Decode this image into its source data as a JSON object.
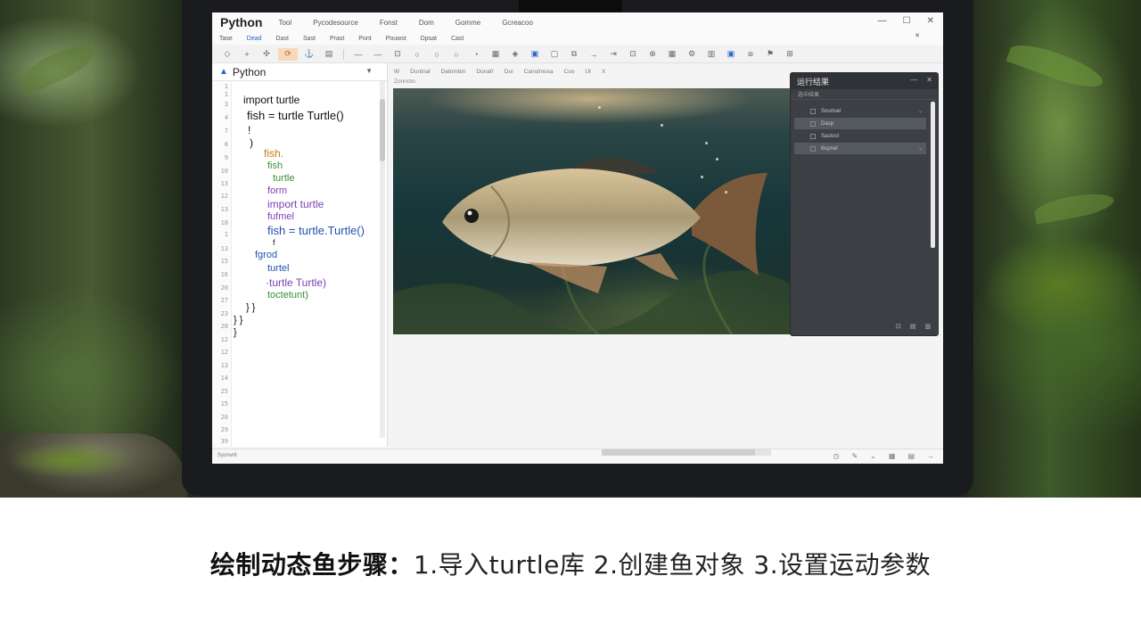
{
  "window": {
    "app_title": "Python",
    "title_menus": [
      "Tool",
      "Pycodesource",
      "Fonst",
      "Dom",
      "Gomme",
      "Gcreacoo"
    ],
    "controls": [
      "—",
      "☐",
      "✕"
    ]
  },
  "menubar": {
    "items": [
      "Tase",
      "Dead",
      "Dast",
      "Sast",
      "Prast",
      "Pont",
      "Pouwst",
      "Dpsat",
      "Cast"
    ],
    "active_index": 1,
    "close": "✕"
  },
  "editor": {
    "tab_title": "Python",
    "line_numbers": [
      "1",
      "1",
      "3",
      "4",
      "7",
      "8",
      "9",
      "10",
      "13",
      "12",
      "13",
      "18",
      "1",
      "13",
      "15",
      "16",
      "20",
      "27",
      "23",
      "28",
      "12",
      "12",
      "13",
      "14",
      "25",
      "15",
      "20",
      "29",
      "39"
    ],
    "code_lines": [
      {
        "text": "import turtle",
        "color": "#111111"
      },
      {
        "text": "fish = turtle Turtle()",
        "color": "#111111"
      },
      {
        "text": "!",
        "color": "#111111"
      },
      {
        "text": ")",
        "color": "#111111"
      },
      {
        "text": "fish.",
        "color": "#c07a10"
      },
      {
        "text": "fish",
        "color": "#3b8e3b"
      },
      {
        "text": "turtle",
        "color": "#3b8e3b"
      },
      {
        "text": "form",
        "color": "#7b3fb5"
      },
      {
        "text": "import turtle",
        "color": "#7b3fb5"
      },
      {
        "text": "fufmel",
        "color": "#7b3fb5"
      },
      {
        "text": "fish = turtle.Turtle()",
        "color": "#2350b0"
      },
      {
        "text": "f",
        "color": "#111111"
      },
      {
        "text": "fgrod",
        "color": "#2350b0"
      },
      {
        "text": "turtel",
        "color": "#2350b0"
      },
      {
        "text": "·turtle Turtle)",
        "color": "#7b3fb5"
      },
      {
        "text": "toctetunt)",
        "color": "#3b8e3b"
      },
      {
        "text": "} }",
        "color": "#111111"
      },
      {
        "text": "}  }",
        "color": "#111111"
      },
      {
        "text": "}",
        "color": "#111111"
      }
    ]
  },
  "subbar": {
    "items": [
      "W",
      "Duntnal",
      "Datnmbin",
      "Donafr",
      "Dui",
      "Canstmosa",
      "Coo",
      "Ut",
      "X"
    ],
    "breadcrumb": "Zonnoto"
  },
  "panel": {
    "title": "运行结果",
    "subtitle": "选中结果",
    "controls": [
      "—",
      "✕"
    ],
    "rows": [
      "Sourtuel",
      "Dasp",
      "Sastool",
      "Bupnel"
    ],
    "selected_indices": [
      1,
      3
    ]
  },
  "statusbar": {
    "text": "Syorwrit"
  },
  "caption": {
    "lead": "绘制动态鱼步骤：",
    "steps": "1.导入turtle库  2.创建鱼对象  3.设置运动参数"
  }
}
